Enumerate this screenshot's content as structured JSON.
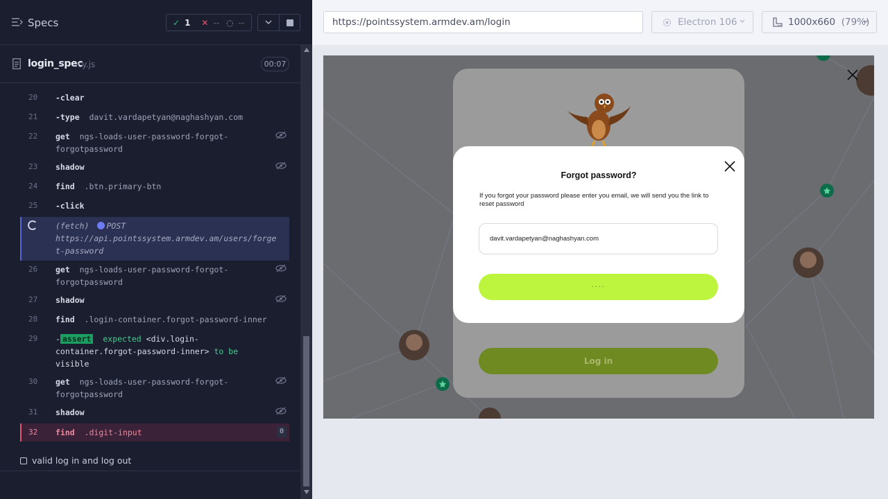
{
  "reporter": {
    "title": "Specs",
    "stats": {
      "passed": "1",
      "failed": "--",
      "pending": "--"
    },
    "file": {
      "name": "login_spec",
      "ext": ".cy.js",
      "duration": "00:07"
    },
    "commands": [
      {
        "num": "20",
        "name": "-clear",
        "message": ""
      },
      {
        "num": "21",
        "name": "-type",
        "message": "davit.vardapetyan@naghashyan.com"
      },
      {
        "num": "22",
        "name": "get",
        "message": "ngs-loads-user-password-forgot-",
        "message2": "forgotpassword"
      },
      {
        "num": "23",
        "name": "shadow",
        "message": ""
      },
      {
        "num": "24",
        "name": "find",
        "message": ".btn.primary-btn"
      },
      {
        "num": "25",
        "name": "-click",
        "message": ""
      },
      {
        "num": "",
        "name": "(fetch)",
        "method": "POST",
        "url1": "https://api.pointssystem.armdev.am/users/forge",
        "url2": "t-password"
      },
      {
        "num": "26",
        "name": "get",
        "message": "ngs-loads-user-password-forgot-",
        "message2": "forgotpassword"
      },
      {
        "num": "27",
        "name": "shadow",
        "message": ""
      },
      {
        "num": "28",
        "name": "find",
        "message": ".login-container.forgot-password-inner"
      },
      {
        "num": "29",
        "name": "assert",
        "prefix": "-",
        "p1": "expected",
        "p2": "<div.login-",
        "p3": "container.forgot-password-inner>",
        "p4": "to be",
        "p5": "visible"
      },
      {
        "num": "30",
        "name": "get",
        "message": "ngs-loads-user-password-forgot-",
        "message2": "forgotpassword"
      },
      {
        "num": "31",
        "name": "shadow",
        "message": ""
      },
      {
        "num": "32",
        "name": "find",
        "message": ".digit-input",
        "count": "0"
      }
    ],
    "next_test": "valid log in and log out"
  },
  "topbar": {
    "url": "https://pointssystem.armdev.am/login",
    "browser": "Electron 106",
    "viewport": "1000x660",
    "scale": "(79%)"
  },
  "app": {
    "login_button": "Log in",
    "modal": {
      "title": "Forgot password?",
      "description": "If you forgot your password please enter you email, we will send you the link to reset password",
      "email_value": "davit.vardapetyan@naghashyan.com",
      "submit_loading": "...."
    }
  },
  "colors": {
    "reporter_bg": "#1b1e2e",
    "accent_green": "#bdf53e",
    "fail_red": "#e45770",
    "pass_green": "#1fc17a"
  }
}
